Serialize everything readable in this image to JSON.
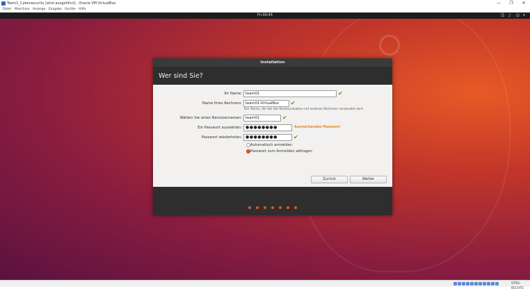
{
  "host_window": {
    "title": "Team1_Cybersecurity [wird ausgeführt] - Oracle VM VirtualBox",
    "controls": [
      "—",
      "❐",
      "✕"
    ]
  },
  "host_menu": [
    "Datei",
    "Maschine",
    "Anzeige",
    "Eingabe",
    "Geräte",
    "Hilfe"
  ],
  "topbar": {
    "clock": "Fri 00:45",
    "tray_icons": [
      "network-icon",
      "volume-icon",
      "power-icon",
      "chevron-down-icon"
    ]
  },
  "dialog": {
    "window_title": "Installation",
    "heading": "Wer sind Sie?",
    "fields": {
      "name": {
        "label": "Ihr Name:",
        "value": "team01"
      },
      "computer": {
        "label": "Name Ihres Rechners:",
        "value": "team01-VirtualBox",
        "hint": "Der Name, der bei der Kommunikation mit anderen Rechnern verwendet wird."
      },
      "username": {
        "label": "Wählen Sie einen Benutzernamen:",
        "value": "team01"
      },
      "password": {
        "label": "Ein Passwort auswählen:",
        "value": "●●●●●●●●",
        "strength": "Ausreichendes Passwort"
      },
      "password_repeat": {
        "label": "Passwort wiederholen:",
        "value": "●●●●●●●●"
      }
    },
    "login_options": [
      {
        "label": "Automatisch anmelden",
        "selected": false
      },
      {
        "label": "Passwort zum Anmelden abfragen",
        "selected": true
      }
    ],
    "buttons": {
      "back": "Zurück",
      "next": "Weiter"
    },
    "progress": {
      "total_steps": 7
    },
    "accent_color": "#e95420",
    "check_color": "#4e9a06",
    "strength_color": "#e08a1e"
  },
  "statusbar": {
    "hostkey": "STRG-RECHTS"
  }
}
